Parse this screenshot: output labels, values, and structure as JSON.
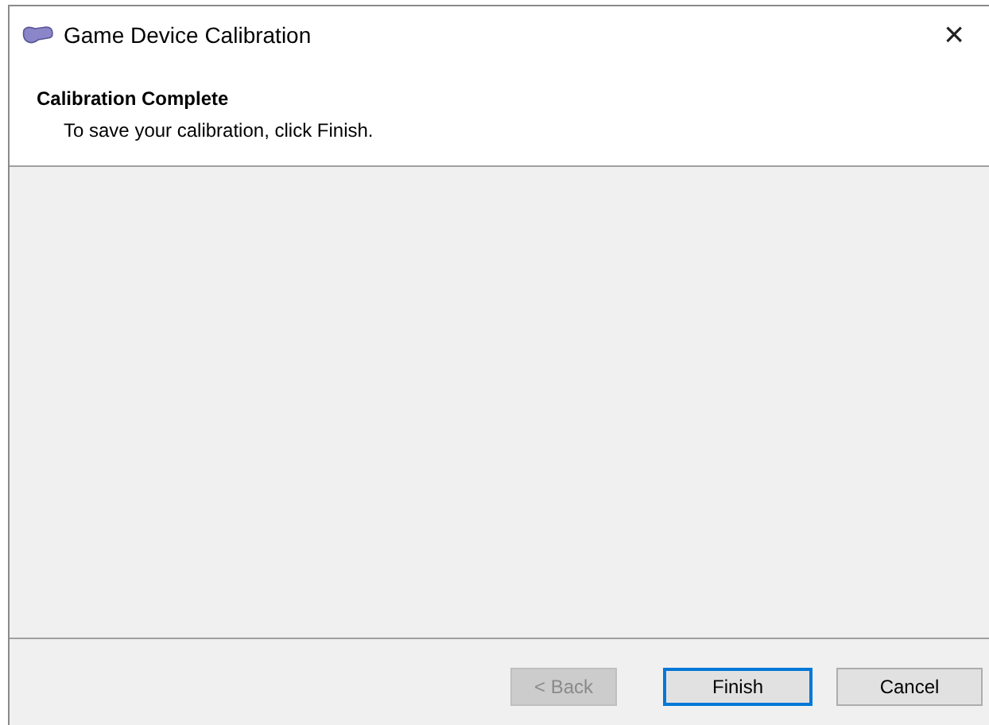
{
  "window": {
    "title": "Game Device Calibration",
    "close": "×"
  },
  "header": {
    "title": "Calibration Complete",
    "subtitle": "To save your calibration, click Finish."
  },
  "buttons": [
    {
      "label": "< Back",
      "disabled": true,
      "default": false
    },
    {
      "label": "Finish",
      "disabled": false,
      "default": true
    },
    {
      "label": "Cancel",
      "disabled": false,
      "default": false
    }
  ]
}
